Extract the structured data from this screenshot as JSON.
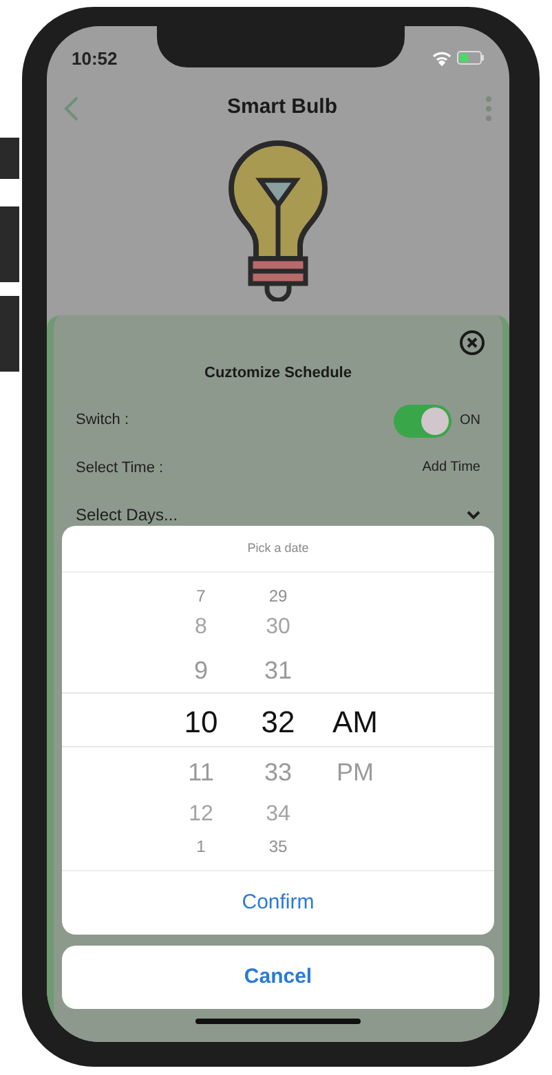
{
  "status_bar": {
    "time": "10:52"
  },
  "nav": {
    "title": "Smart Bulb"
  },
  "schedule": {
    "title": "Cuztomize Schedule",
    "switch": {
      "label": "Switch :",
      "on": true,
      "state_text": "ON"
    },
    "time_row": {
      "label": "Select Time :",
      "action": "Add Time"
    },
    "days_row": {
      "label": "Select Days..."
    }
  },
  "picker": {
    "title": "Pick a date",
    "columns": [
      [
        {
          "label": "7",
          "selected": false
        },
        {
          "label": "8",
          "selected": false
        },
        {
          "label": "9",
          "selected": false
        },
        {
          "label": "10",
          "selected": true
        },
        {
          "label": "11",
          "selected": false
        },
        {
          "label": "12",
          "selected": false
        },
        {
          "label": "1",
          "selected": false
        }
      ],
      [
        {
          "label": "29",
          "selected": false
        },
        {
          "label": "30",
          "selected": false
        },
        {
          "label": "31",
          "selected": false
        },
        {
          "label": "32",
          "selected": true
        },
        {
          "label": "33",
          "selected": false
        },
        {
          "label": "34",
          "selected": false
        },
        {
          "label": "35",
          "selected": false
        }
      ],
      [
        {
          "label": "AM",
          "selected": true
        },
        {
          "label": "PM",
          "selected": false
        }
      ]
    ],
    "confirm": "Confirm",
    "cancel": "Cancel"
  }
}
